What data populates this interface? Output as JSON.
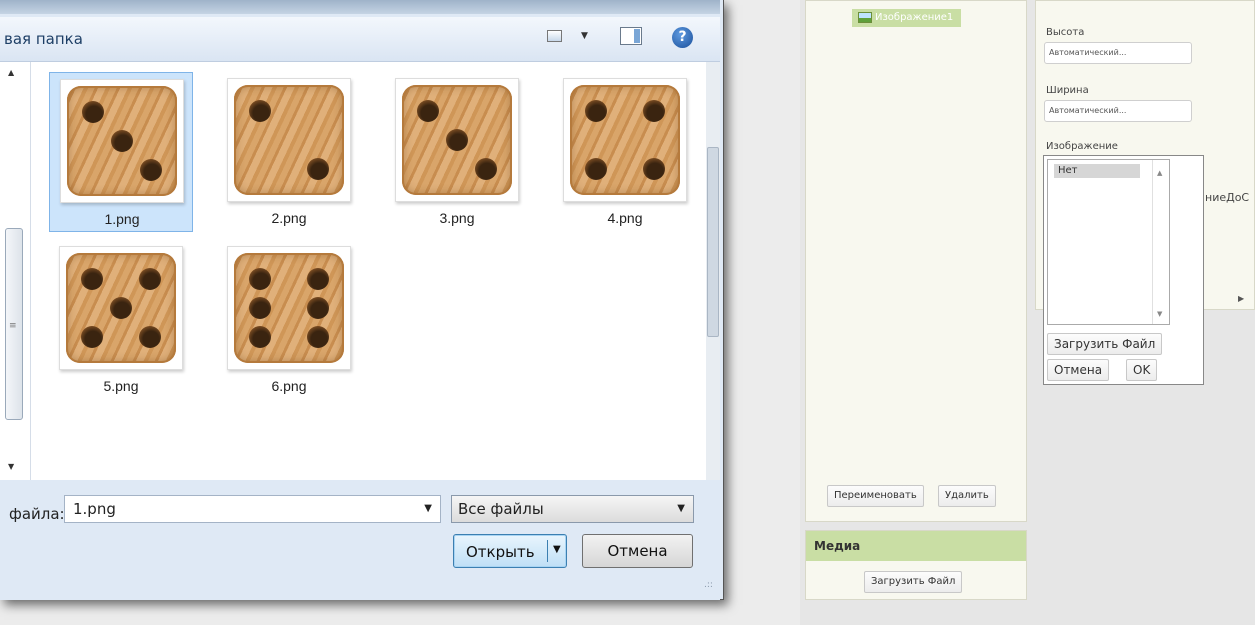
{
  "dialog": {
    "folder_title": "вая папка",
    "help_glyph": "?",
    "files": [
      {
        "name": "1.png",
        "pips": 3,
        "selected": true
      },
      {
        "name": "2.png",
        "pips": 2,
        "selected": false
      },
      {
        "name": "3.png",
        "pips": 3,
        "selected": false
      },
      {
        "name": "4.png",
        "pips": 4,
        "selected": false
      },
      {
        "name": "5.png",
        "pips": 5,
        "selected": false
      },
      {
        "name": "6.png",
        "pips": 6,
        "selected": false
      }
    ],
    "filename_label": "файла:",
    "filename_value": "1.png",
    "filetype_value": "Все файлы",
    "open_label": "Открыть",
    "cancel_label": "Отмена"
  },
  "components": {
    "item_label": "Изображение1",
    "rename_label": "Переименовать",
    "delete_label": "Удалить"
  },
  "media": {
    "header": "Медиа",
    "upload_label": "Загрузить Файл"
  },
  "properties": {
    "height_label": "Высота",
    "height_value": "Автоматический...",
    "width_label": "Ширина",
    "width_value": "Автоматический...",
    "image_label": "Изображение",
    "cut_text": "ниеДоС"
  },
  "picker": {
    "items": [
      "Нет"
    ],
    "upload_label": "Загрузить Файл",
    "cancel_label": "Отмена",
    "ok_label": "OK"
  },
  "colors": {
    "accent_green": "#c9dea4",
    "selection_blue": "#cce4fb",
    "dialog_bg": "#dfe9f5"
  }
}
